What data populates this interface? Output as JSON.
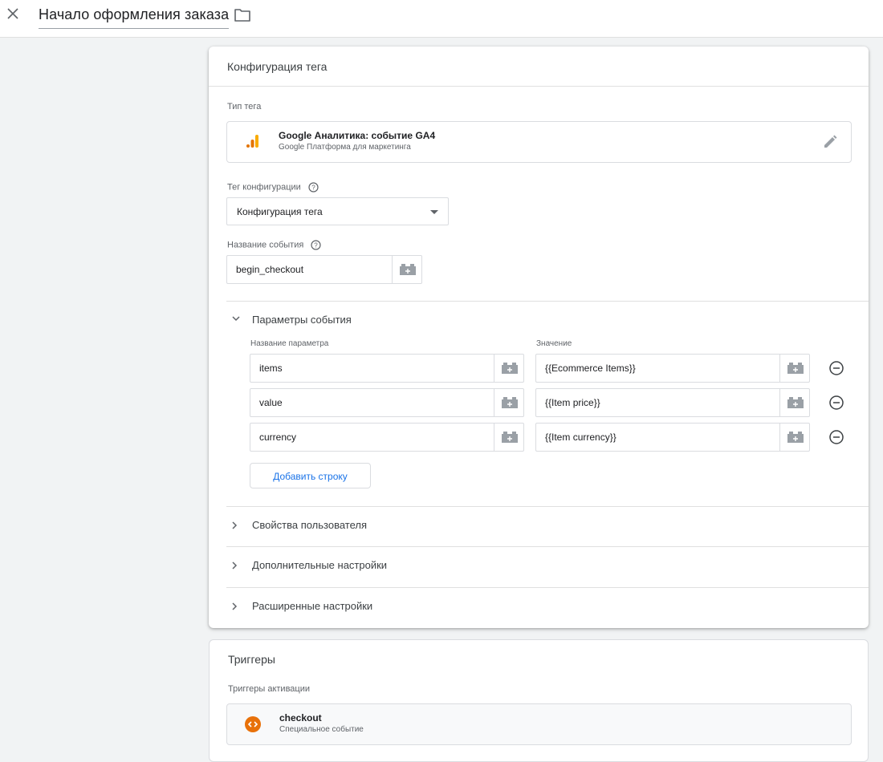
{
  "header": {
    "title": "Начало оформления заказа"
  },
  "tag_config": {
    "card_title": "Конфигурация тега",
    "tag_type_label": "Тип тега",
    "tag_type": {
      "name": "Google Аналитика: событие GA4",
      "subtitle": "Google Платформа для маркетинга"
    },
    "config_tag_label": "Тег конфигурации",
    "config_tag_value": "Конфигурация тега",
    "event_name_label": "Название события",
    "event_name_value": "begin_checkout",
    "event_params": {
      "section_label": "Параметры события",
      "col_name": "Название параметра",
      "col_value": "Значение",
      "rows": [
        {
          "name": "items",
          "value": "{{Ecommerce Items}}"
        },
        {
          "name": "value",
          "value": "{{Item price}}"
        },
        {
          "name": "currency",
          "value": "{{Item currency}}"
        }
      ],
      "add_row_label": "Добавить строку"
    },
    "collapsed_sections": [
      "Свойства пользователя",
      "Дополнительные настройки",
      "Расширенные настройки"
    ]
  },
  "triggers": {
    "card_title": "Триггеры",
    "firing_label": "Триггеры активации",
    "items": [
      {
        "name": "checkout",
        "type": "Специальное событие"
      }
    ]
  },
  "colors": {
    "accent_blue": "#1a73e8",
    "ga_orange": "#f9ab00",
    "trigger_orange": "#e8710a"
  },
  "icons": {
    "close": "close-icon",
    "folder": "folder-icon",
    "edit": "pencil-icon",
    "help": "help-circle-icon",
    "variable": "variable-block-icon",
    "remove": "minus-circle-icon",
    "chevron_down": "chevron-down-icon",
    "chevron_right": "chevron-right-icon",
    "custom_event": "custom-event-icon"
  }
}
